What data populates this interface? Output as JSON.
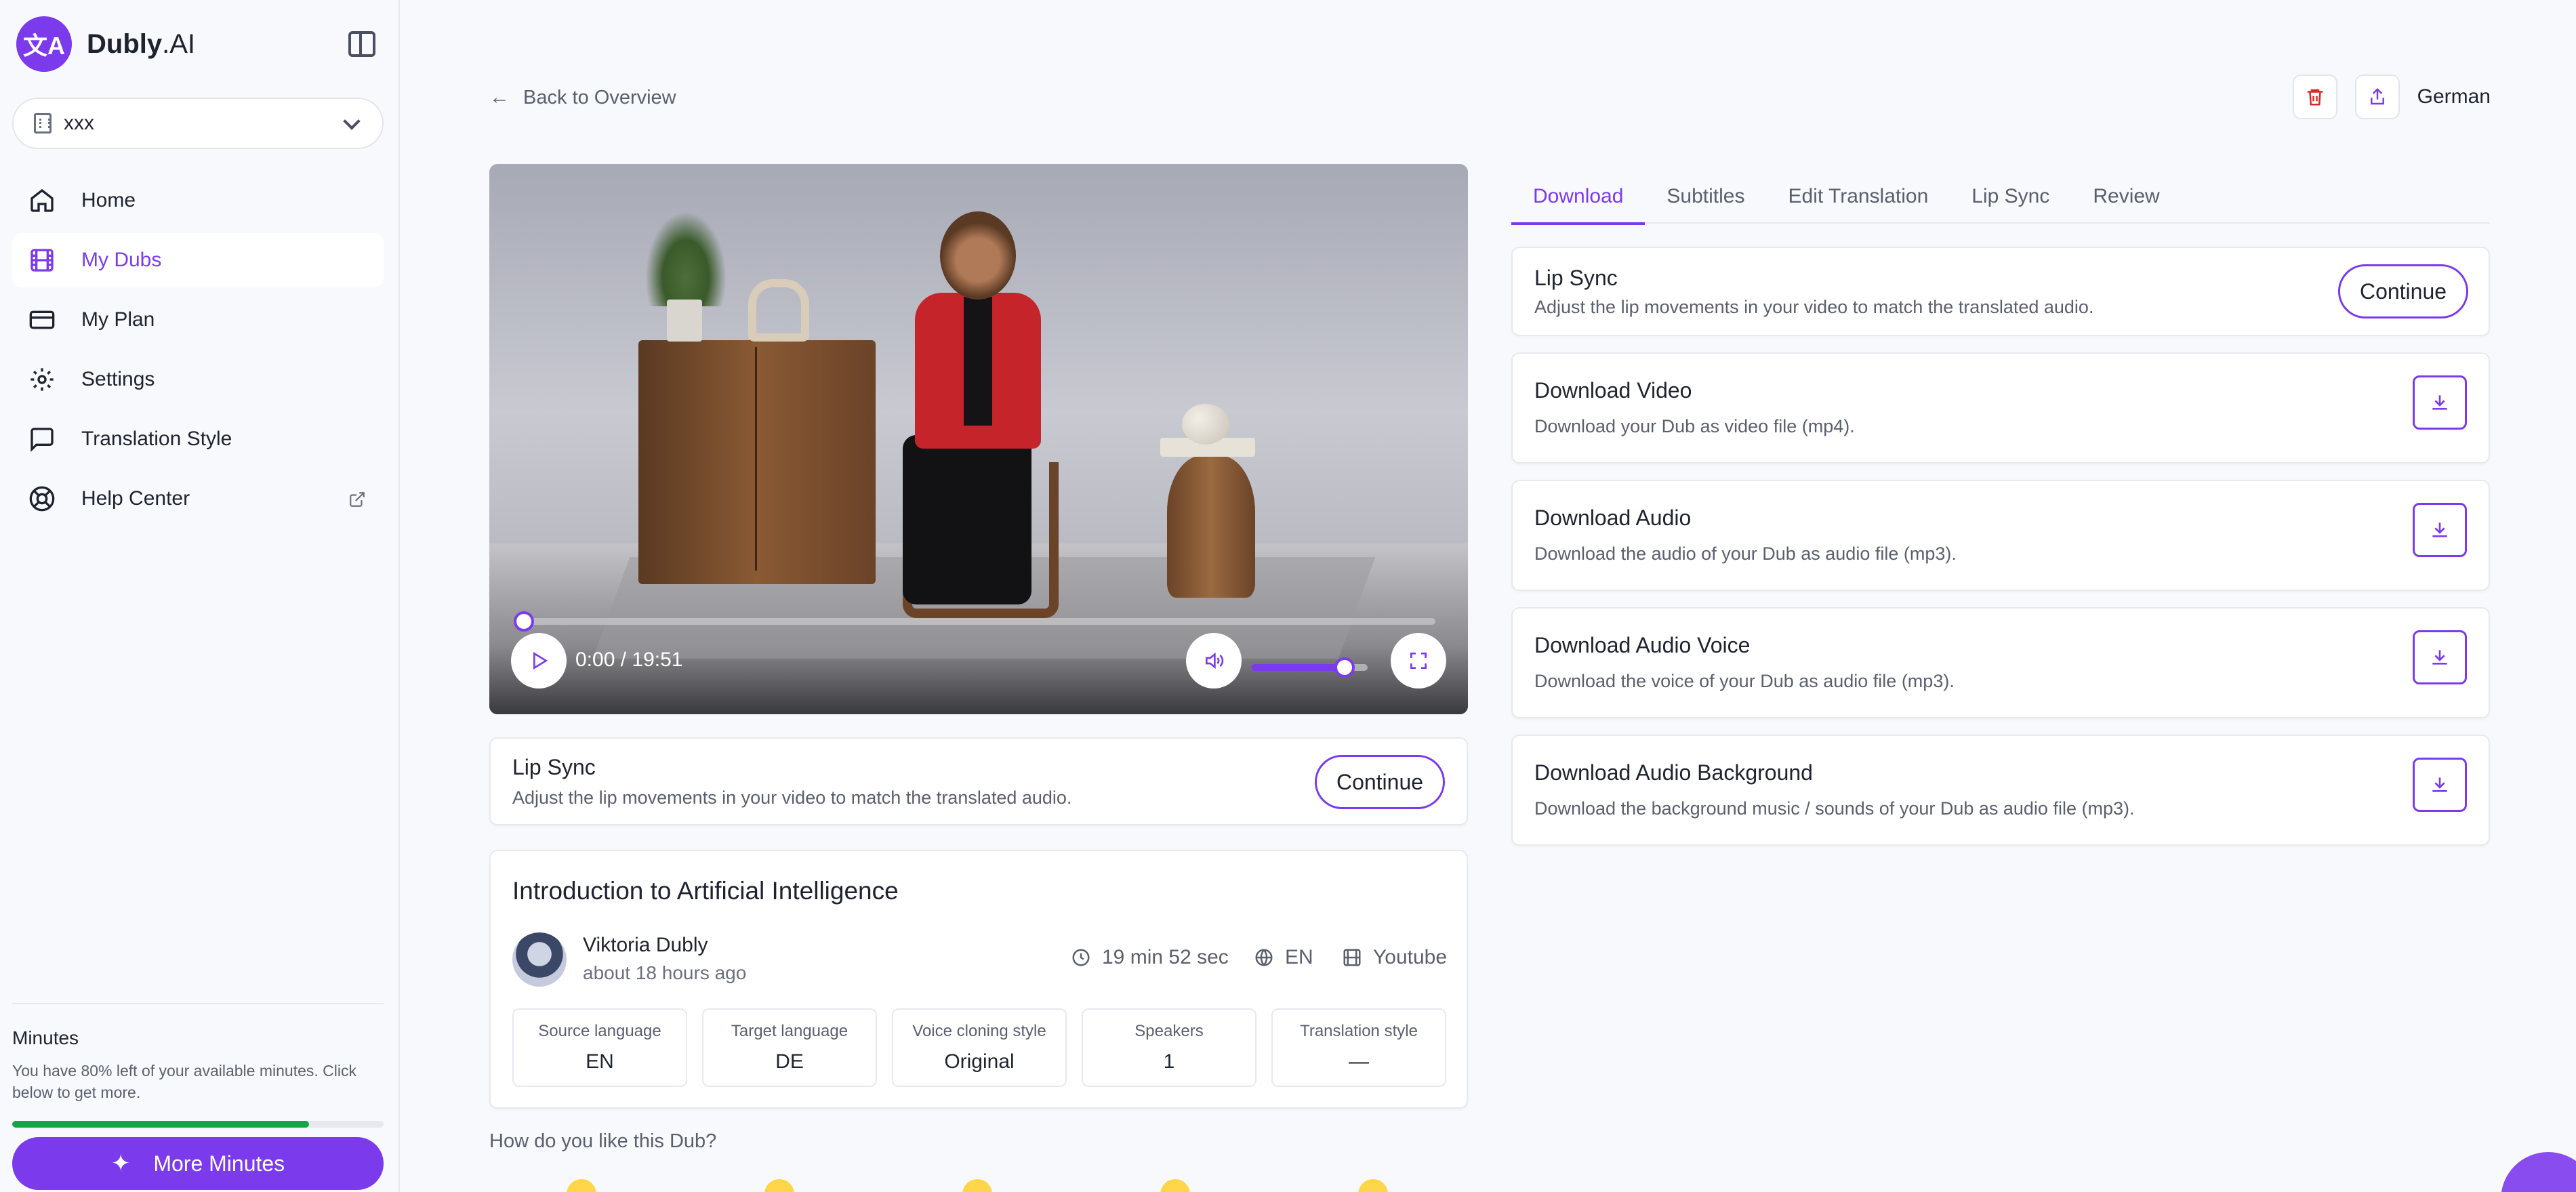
{
  "app": {
    "logo_name": "Dubly",
    "logo_suffix": ".AI",
    "logo_glyph": "文A"
  },
  "workspace": {
    "label": "xxx"
  },
  "nav": [
    {
      "label": "Home",
      "icon": "home-icon"
    },
    {
      "label": "My Dubs",
      "icon": "film-icon",
      "active": true
    },
    {
      "label": "My Plan",
      "icon": "credit-card-icon"
    },
    {
      "label": "Settings",
      "icon": "gear-icon"
    },
    {
      "label": "Translation Style",
      "icon": "chat-bubble-icon"
    },
    {
      "label": "Help Center",
      "icon": "lifebuoy-icon",
      "external": true
    }
  ],
  "minutes": {
    "title": "Minutes",
    "text": "You have 80% left of your available minutes. Click below to get more.",
    "percent_left": 80,
    "button_label": "More Minutes"
  },
  "header": {
    "back_label": "Back to Overview",
    "language": "German"
  },
  "video": {
    "time": "0:00 / 19:51",
    "progress": 0,
    "volume": 0.8
  },
  "lip_sync_card": {
    "title": "Lip Sync",
    "desc": "Adjust the lip movements in your video to match the translated audio.",
    "button": "Continue"
  },
  "info": {
    "title": "Introduction to Artificial Intelligence",
    "author": "Viktoria Dubly",
    "time_ago": "about 18 hours ago",
    "duration": "19 min 52 sec",
    "language": "EN",
    "source": "Youtube",
    "stats": [
      {
        "label": "Source language",
        "value": "EN"
      },
      {
        "label": "Target language",
        "value": "DE"
      },
      {
        "label": "Voice cloning style",
        "value": "Original"
      },
      {
        "label": "Speakers",
        "value": "1"
      },
      {
        "label": "Translation style",
        "value": "—"
      }
    ]
  },
  "rating": {
    "question": "How do you like this Dub?"
  },
  "tabs": [
    "Download",
    "Subtitles",
    "Edit Translation",
    "Lip Sync",
    "Review"
  ],
  "downloads": [
    {
      "title": "Download Video",
      "desc": "Download your Dub as video file (mp4)."
    },
    {
      "title": "Download Audio",
      "desc": "Download the audio of your Dub as audio file (mp3)."
    },
    {
      "title": "Download Audio Voice",
      "desc": "Download the voice of your Dub as audio file (mp3)."
    },
    {
      "title": "Download Audio Background",
      "desc": "Download the background music / sounds of your Dub as audio file (mp3)."
    }
  ],
  "colors": {
    "accent": "#7c3aed",
    "success": "#16a34a",
    "danger": "#dc2626"
  }
}
